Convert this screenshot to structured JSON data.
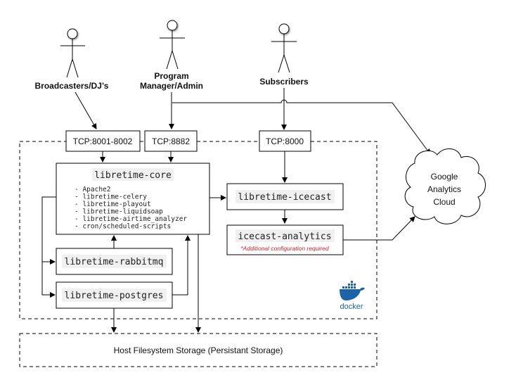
{
  "actors": {
    "broadcasters": {
      "label": "Broadcasters/DJ’s"
    },
    "manager": {
      "label_line1": "Program",
      "label_line2": "Manager/Admin"
    },
    "subscribers": {
      "label": "Subscribers"
    }
  },
  "ports": {
    "broadcast": "TCP:8001-8002",
    "admin": "TCP:8882",
    "stream": "TCP:8000"
  },
  "services": {
    "core": {
      "title": "libretime-core",
      "items": [
        "- Apache2",
        "- libretime-celery",
        "- libretime-playout",
        "- libretime-liquidsoap",
        "- libretime-airtime_analyzer",
        "- cron/scheduled-scripts"
      ]
    },
    "rabbitmq": "libretime-rabbitmq",
    "postgres": "libretime-postgres",
    "icecast": "libretime-icecast",
    "analytics": {
      "title": "icecast-analytics",
      "note": "*Additional configuration required"
    }
  },
  "cloud": {
    "line1": "Google",
    "line2": "Analytics",
    "line3": "Cloud"
  },
  "docker": {
    "label": "docker"
  },
  "storage": {
    "label": "Host Filesystem Storage (Persistant Storage)"
  },
  "colors": {
    "note": "#c0272d",
    "docker": "#1d63a8",
    "label_bg": "#f0f0f0"
  }
}
